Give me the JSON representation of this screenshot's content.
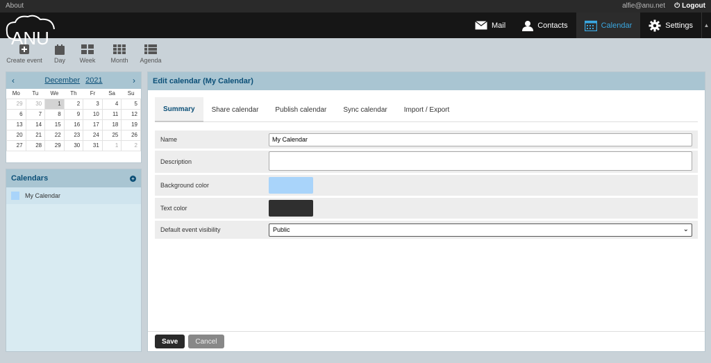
{
  "topbar": {
    "about": "About",
    "user": "alfie@anu.net",
    "logout": "Logout"
  },
  "logo_text": "ANU",
  "nav": {
    "mail": "Mail",
    "contacts": "Contacts",
    "calendar": "Calendar",
    "settings": "Settings",
    "active_color": "#3aa7e0"
  },
  "toolbar": {
    "create_event": "Create event",
    "day": "Day",
    "week": "Week",
    "month": "Month",
    "agenda": "Agenda"
  },
  "minical": {
    "month": "December",
    "year": "2021",
    "weekdays": [
      "Mo",
      "Tu",
      "We",
      "Th",
      "Fr",
      "Sa",
      "Su"
    ],
    "weeks": [
      [
        "29",
        "30",
        "1",
        "2",
        "3",
        "4",
        "5"
      ],
      [
        "6",
        "7",
        "8",
        "9",
        "10",
        "11",
        "12"
      ],
      [
        "13",
        "14",
        "15",
        "16",
        "17",
        "18",
        "19"
      ],
      [
        "20",
        "21",
        "22",
        "23",
        "24",
        "25",
        "26"
      ],
      [
        "27",
        "28",
        "29",
        "30",
        "31",
        "1",
        "2"
      ]
    ]
  },
  "calendars": {
    "title": "Calendars",
    "items": [
      {
        "name": "My Calendar",
        "color": "#a9d4fa"
      }
    ]
  },
  "edit": {
    "title": "Edit calendar (My Calendar)",
    "tabs": [
      "Summary",
      "Share calendar",
      "Publish calendar",
      "Sync calendar",
      "Import / Export"
    ],
    "fields": {
      "name_label": "Name",
      "name_value": "My Calendar",
      "description_label": "Description",
      "bg_label": "Background color",
      "bg_color": "#a9d4fa",
      "text_label": "Text color",
      "text_color": "#2f2f2f",
      "visibility_label": "Default event visibility",
      "visibility_value": "Public"
    },
    "save": "Save",
    "cancel": "Cancel"
  }
}
